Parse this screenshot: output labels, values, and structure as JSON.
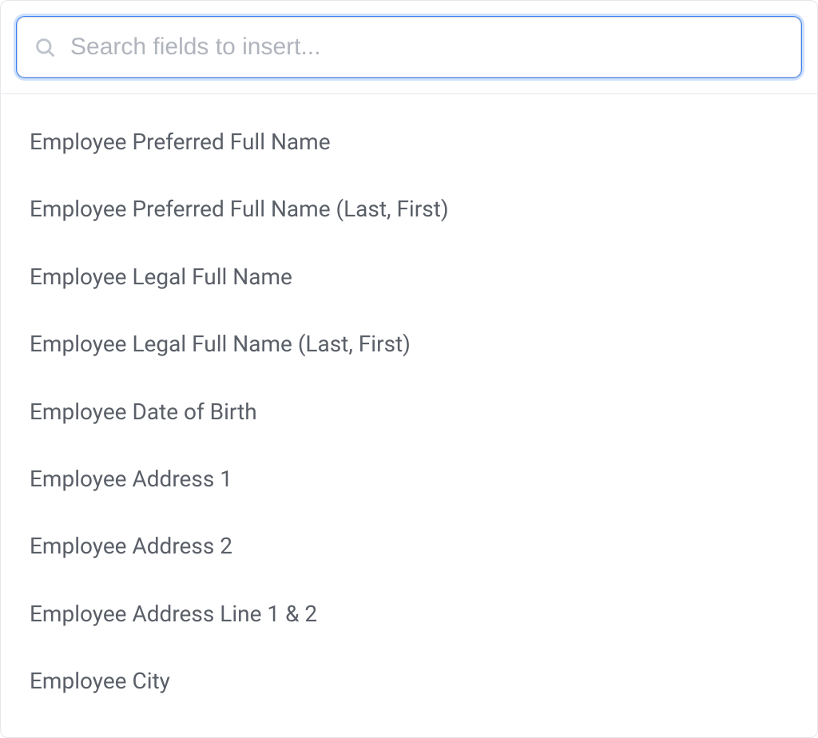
{
  "search": {
    "placeholder": "Search fields to insert...",
    "value": ""
  },
  "fields": [
    {
      "label": "Employee Preferred Full Name"
    },
    {
      "label": "Employee Preferred Full Name (Last, First)"
    },
    {
      "label": "Employee Legal Full Name"
    },
    {
      "label": "Employee Legal Full Name (Last, First)"
    },
    {
      "label": "Employee Date of Birth"
    },
    {
      "label": "Employee Address 1"
    },
    {
      "label": "Employee Address 2"
    },
    {
      "label": "Employee Address Line 1 & 2"
    },
    {
      "label": "Employee City"
    }
  ]
}
